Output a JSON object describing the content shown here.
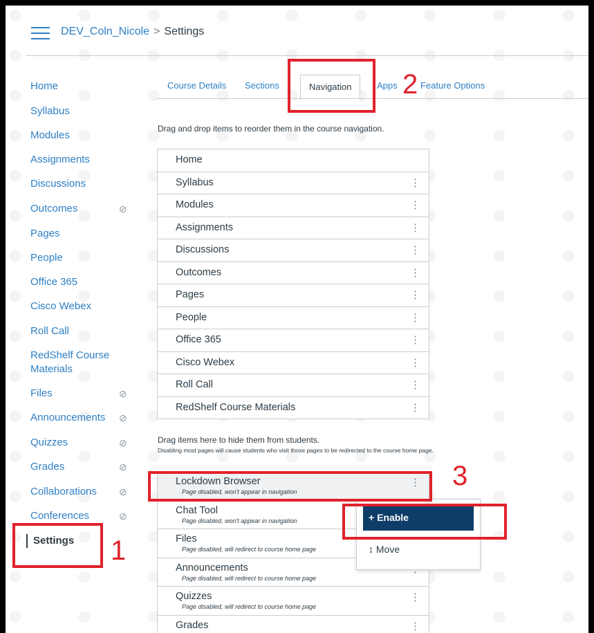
{
  "breadcrumb": {
    "course": "DEV_Coln_Nicole",
    "separator": ">",
    "current": "Settings"
  },
  "left_nav": [
    {
      "label": "Home",
      "hidden": false
    },
    {
      "label": "Syllabus",
      "hidden": false
    },
    {
      "label": "Modules",
      "hidden": false
    },
    {
      "label": "Assignments",
      "hidden": false
    },
    {
      "label": "Discussions",
      "hidden": false
    },
    {
      "label": "Outcomes",
      "hidden": true
    },
    {
      "label": "Pages",
      "hidden": false
    },
    {
      "label": "People",
      "hidden": false
    },
    {
      "label": "Office 365",
      "hidden": false
    },
    {
      "label": "Cisco Webex",
      "hidden": false
    },
    {
      "label": "Roll Call",
      "hidden": false
    },
    {
      "label": "RedShelf Course Materials",
      "hidden": false
    },
    {
      "label": "Files",
      "hidden": true
    },
    {
      "label": "Announcements",
      "hidden": true
    },
    {
      "label": "Quizzes",
      "hidden": true
    },
    {
      "label": "Grades",
      "hidden": true
    },
    {
      "label": "Collaborations",
      "hidden": true
    },
    {
      "label": "Conferences",
      "hidden": true
    },
    {
      "label": "Settings",
      "hidden": false,
      "active": true
    }
  ],
  "tabs": [
    {
      "label": "Course Details"
    },
    {
      "label": "Sections"
    },
    {
      "label": "Navigation",
      "active": true
    },
    {
      "label": "Apps"
    },
    {
      "label": "Feature Options"
    }
  ],
  "instructions": "Drag and drop items to reorder them in the course navigation.",
  "enabled_items": [
    "Home",
    "Syllabus",
    "Modules",
    "Assignments",
    "Discussions",
    "Outcomes",
    "Pages",
    "People",
    "Office 365",
    "Cisco Webex",
    "Roll Call",
    "RedShelf Course Materials"
  ],
  "hidden_heading": "Drag items here to hide them from students.",
  "hidden_subheading": "Disabling most pages will cause students who visit those pages to be redirected to the course home page.",
  "hidden_items": [
    {
      "label": "Lockdown Browser",
      "note": "Page disabled, won't appear in navigation"
    },
    {
      "label": "Chat Tool",
      "note": "Page disabled, won't appear in navigation"
    },
    {
      "label": "Files",
      "note": "Page disabled, will redirect to course home page"
    },
    {
      "label": "Announcements",
      "note": "Page disabled, will redirect to course home page"
    },
    {
      "label": "Quizzes",
      "note": "Page disabled, will redirect to course home page"
    },
    {
      "label": "Grades",
      "note": ""
    }
  ],
  "menu": {
    "enable_label": "+ Enable",
    "move_label": "↕ Move"
  },
  "annotations": {
    "n1": "1",
    "n2": "2",
    "n3": "3"
  },
  "kebab_glyph": "⋮",
  "eye_glyph": "⊘"
}
